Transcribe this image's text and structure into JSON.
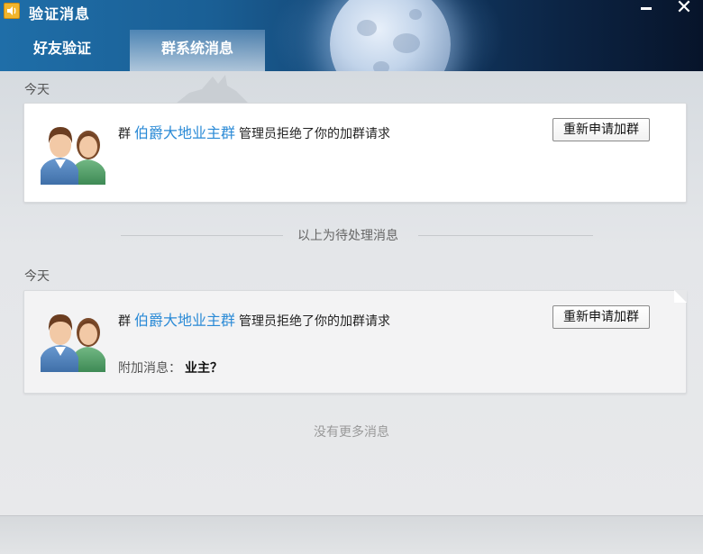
{
  "window": {
    "title": "验证消息",
    "app_icon": "speaker-icon",
    "minimize_icon": "minimize-icon",
    "close_icon": "close-icon",
    "close_glyph": "✕"
  },
  "tabs": [
    {
      "label": "好友验证",
      "selected": false
    },
    {
      "label": "群系统消息",
      "selected": true
    }
  ],
  "sections": {
    "pending": {
      "date": "今天",
      "message": {
        "prefix": "群",
        "group_name": "伯爵大地业主群",
        "suffix": "管理员拒绝了你的加群请求",
        "button_label": "重新申请加群",
        "avatar_icon": "group-avatar-icon"
      }
    },
    "divider_text": "以上为待处理消息",
    "processed": {
      "date": "今天",
      "message": {
        "prefix": "群",
        "group_name": "伯爵大地业主群",
        "suffix": "管理员拒绝了你的加群请求",
        "button_label": "重新申请加群",
        "extra_label": "附加消息：",
        "extra_value": "业主？",
        "avatar_icon": "group-avatar-icon"
      }
    },
    "no_more_text": "没有更多消息"
  },
  "colors": {
    "accent_link": "#2a8ad6",
    "header_start": "#1f6ea8",
    "header_end": "#07142a"
  }
}
